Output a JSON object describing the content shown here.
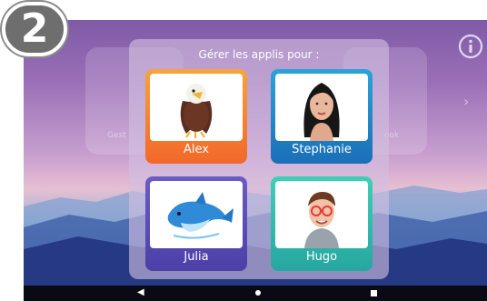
{
  "step_badge": {
    "number": "2"
  },
  "dialog": {
    "title": "Gérer les applis pour :"
  },
  "profiles": [
    {
      "name": "Alex",
      "avatar": "eagle-avatar",
      "color": "#f2682a"
    },
    {
      "name": "Stephanie",
      "avatar": "woman-avatar",
      "color": "#1b6fb8"
    },
    {
      "name": "Julia",
      "avatar": "dolphin-avatar",
      "color": "#4d3fa8"
    },
    {
      "name": "Hugo",
      "avatar": "man-glasses-avatar",
      "color": "#26a7a0"
    }
  ],
  "background": {
    "left_tile_label": "Gest",
    "right_tile_label": "ook"
  },
  "icons": {
    "info": "info-icon",
    "back": "back-triangle-icon",
    "home": "home-dot-icon",
    "recent": "recents-square-icon"
  }
}
